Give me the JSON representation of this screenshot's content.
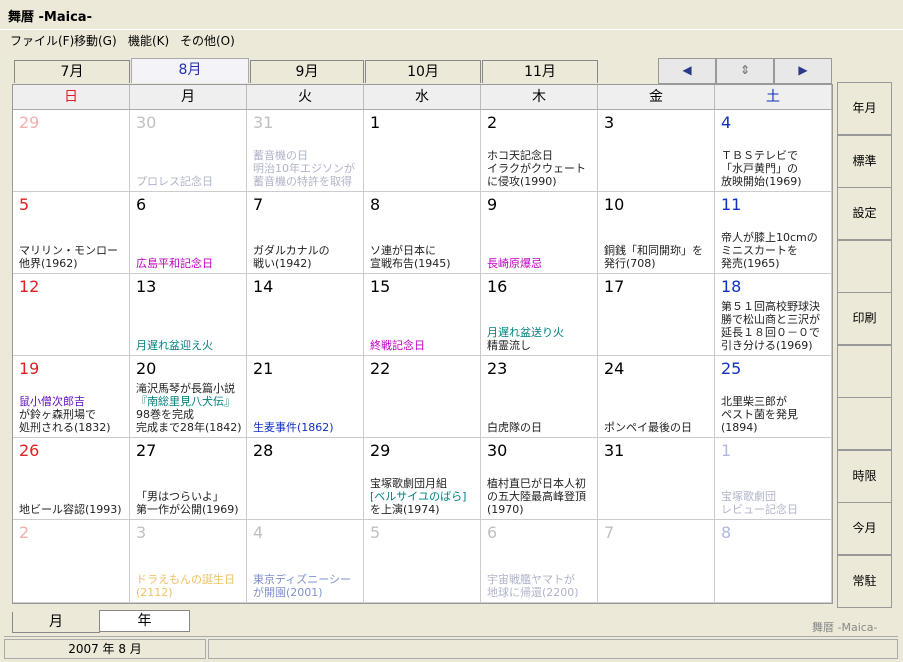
{
  "window": {
    "title": "舞暦 -Maica-"
  },
  "menu": [
    "ファイル(F)",
    "移動(G)",
    "機能(K)",
    "その他(O)"
  ],
  "month_tabs": [
    "7月",
    "8月",
    "9月",
    "10月",
    "11月"
  ],
  "selected_month_tab": 1,
  "nav": {
    "prev": "◀",
    "next": "▶",
    "mid": "⇕"
  },
  "weekdays": [
    "日",
    "月",
    "火",
    "水",
    "木",
    "金",
    "土"
  ],
  "colors": {
    "sun": "#e02020",
    "sat": "#1030c0",
    "dim": "#c0c0c0",
    "event": "#222222",
    "pink": "#c000c0",
    "teal": "#008080",
    "blue": "#1030c0",
    "purple": "#6010c0"
  },
  "weeks": [
    [
      {
        "d": "29",
        "dim": true,
        "events": []
      },
      {
        "d": "30",
        "dim": true,
        "events": [
          {
            "t": "プロレス記念日",
            "c": "dim"
          }
        ]
      },
      {
        "d": "31",
        "dim": true,
        "events": [
          {
            "t": "蓄音機の日\n明治10年エジソンが\n蓄音機の特許を取得",
            "c": "dim"
          }
        ]
      },
      {
        "d": "1",
        "events": []
      },
      {
        "d": "2",
        "events": [
          {
            "t": "ホコ天記念日\nイラクがクウェート\nに侵攻(1990)",
            "c": "event"
          }
        ]
      },
      {
        "d": "3",
        "events": []
      },
      {
        "d": "4",
        "events": [
          {
            "t": "ＴＢＳテレビで\n「水戸黄門」の\n放映開始(1969)",
            "c": "event"
          }
        ]
      }
    ],
    [
      {
        "d": "5",
        "events": [
          {
            "t": "マリリン・モンロー\n他界(1962)",
            "c": "event"
          }
        ]
      },
      {
        "d": "6",
        "events": [
          {
            "t": "広島平和記念日",
            "c": "pink"
          }
        ]
      },
      {
        "d": "7",
        "events": [
          {
            "t": "ガダルカナルの\n戦い(1942)",
            "c": "event"
          }
        ]
      },
      {
        "d": "8",
        "events": [
          {
            "t": "ソ連が日本に\n宣戦布告(1945)",
            "c": "event"
          }
        ]
      },
      {
        "d": "9",
        "events": [
          {
            "t": "長崎原爆忌",
            "c": "pink"
          }
        ]
      },
      {
        "d": "10",
        "events": [
          {
            "t": "銅銭「和同開珎」を\n発行(708)",
            "c": "event"
          }
        ]
      },
      {
        "d": "11",
        "events": [
          {
            "t": "帝人が膝上10cmの\nミニスカートを\n発売(1965)",
            "c": "event"
          }
        ]
      }
    ],
    [
      {
        "d": "12",
        "events": []
      },
      {
        "d": "13",
        "events": [
          {
            "t": "月遅れ盆迎え火",
            "c": "teal"
          }
        ]
      },
      {
        "d": "14",
        "events": []
      },
      {
        "d": "15",
        "events": [
          {
            "t": "終戦記念日",
            "c": "pink"
          }
        ]
      },
      {
        "d": "16",
        "events": [
          {
            "t": "月遅れ盆送り火",
            "c": "teal"
          },
          {
            "t": "精霊流し",
            "c": "event"
          }
        ]
      },
      {
        "d": "17",
        "events": []
      },
      {
        "d": "18",
        "events": [
          {
            "t": "第５１回高校野球決\n勝で松山商と三沢が\n延長１８回０－０で\n引き分ける(1969)",
            "c": "event"
          }
        ]
      }
    ],
    [
      {
        "d": "19",
        "events": [
          {
            "t": "鼠小僧次郎吉",
            "c": "purple"
          },
          {
            "t": "が鈴ヶ森刑場で\n処刑される(1832)",
            "c": "event"
          }
        ]
      },
      {
        "d": "20",
        "events": [
          {
            "t": "滝沢馬琴が長篇小説",
            "c": "event"
          },
          {
            "t": "『南総里見八犬伝』",
            "c": "teal"
          },
          {
            "t": "98巻を完成\n完成まで28年(1842)",
            "c": "event"
          }
        ]
      },
      {
        "d": "21",
        "events": [
          {
            "t": "生麦事件(1862)",
            "c": "blue"
          }
        ]
      },
      {
        "d": "22",
        "events": []
      },
      {
        "d": "23",
        "events": [
          {
            "t": "白虎隊の日",
            "c": "event"
          }
        ]
      },
      {
        "d": "24",
        "events": [
          {
            "t": "ポンペイ最後の日",
            "c": "event"
          }
        ]
      },
      {
        "d": "25",
        "events": [
          {
            "t": "北里柴三郎が\nペスト菌を発見\n(1894)",
            "c": "event"
          }
        ]
      }
    ],
    [
      {
        "d": "26",
        "events": [
          {
            "t": "地ビール容認(1993)",
            "c": "event"
          }
        ]
      },
      {
        "d": "27",
        "events": [
          {
            "t": "「男はつらいよ」\n第一作が公開(1969)",
            "c": "event"
          }
        ]
      },
      {
        "d": "28",
        "events": []
      },
      {
        "d": "29",
        "events": [
          {
            "t": "宝塚歌劇団月組",
            "c": "event"
          },
          {
            "t": "[ベルサイユのばら]",
            "c": "teal"
          },
          {
            "t": "を上演(1974)",
            "c": "event"
          }
        ]
      },
      {
        "d": "30",
        "events": [
          {
            "t": "植村直巳が日本人初\nの五大陸最高峰登頂\n(1970)",
            "c": "event"
          }
        ]
      },
      {
        "d": "31",
        "events": []
      },
      {
        "d": "1",
        "dim": true,
        "events": [
          {
            "t": "宝塚歌劇団\nレビュー記念日",
            "c": "dim"
          }
        ]
      }
    ],
    [
      {
        "d": "2",
        "dim": true,
        "events": []
      },
      {
        "d": "3",
        "dim": true,
        "events": [
          {
            "t": "ドラえもんの誕生日\n(2112)",
            "c": "dimyellow"
          }
        ]
      },
      {
        "d": "4",
        "dim": true,
        "events": [
          {
            "t": "東京ディズニーシー\nが開園(2001)",
            "c": "dimblue"
          }
        ]
      },
      {
        "d": "5",
        "dim": true,
        "events": []
      },
      {
        "d": "6",
        "dim": true,
        "events": [
          {
            "t": "宇宙戦艦ヤマトが\n地球に帰還(2200)",
            "c": "dim"
          }
        ]
      },
      {
        "d": "7",
        "dim": true,
        "events": []
      },
      {
        "d": "8",
        "dim": true,
        "events": []
      }
    ]
  ],
  "sidebar": [
    "年月",
    "標準",
    "設定",
    "",
    "印刷",
    "",
    "",
    "時限",
    "今月",
    "常駐"
  ],
  "bottom_tabs": [
    "月",
    "年"
  ],
  "status": {
    "left": "2007 年 8 月",
    "right": "舞暦 -Maica-"
  }
}
